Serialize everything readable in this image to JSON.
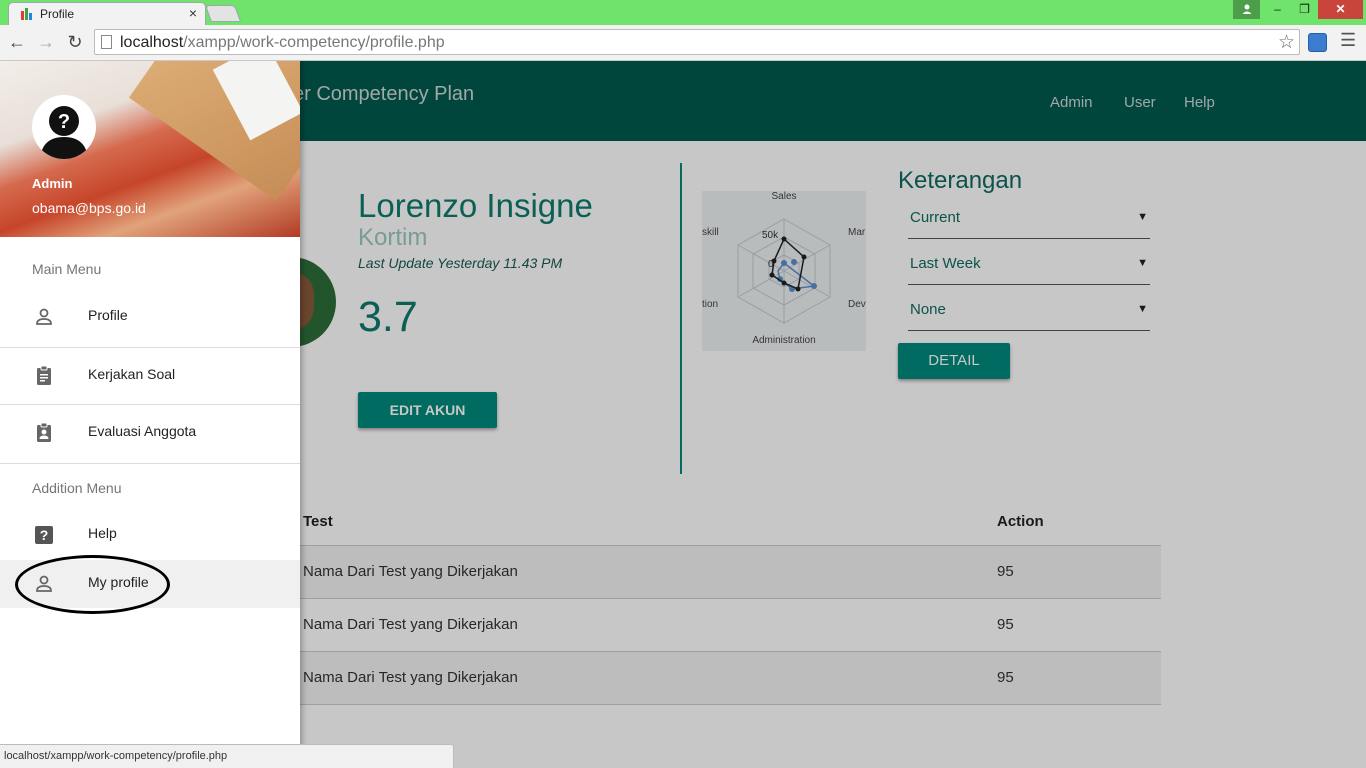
{
  "browser": {
    "tab_title": "Profile",
    "tab_close": "×",
    "url_host": "localhost",
    "url_path": "/xampp/work-competency/profile.php",
    "status_url": "localhost/xampp/work-competency/profile.php",
    "window_buttons": {
      "minimize": "‒",
      "maximize": "❐",
      "close": "✕"
    }
  },
  "header": {
    "title": "e Worker Competency Plan",
    "nav": [
      "Admin",
      "User",
      "Help"
    ]
  },
  "drawer": {
    "user_name": "Admin",
    "user_email": "obama@bps.go.id",
    "main_menu_label": "Main Menu",
    "main_items": [
      {
        "label": "Profile",
        "icon": "person-outline-icon"
      },
      {
        "label": "Kerjakan Soal",
        "icon": "clipboard-icon"
      },
      {
        "label": "Evaluasi Anggota",
        "icon": "assignment-ind-icon"
      }
    ],
    "addition_menu_label": "Addition Menu",
    "addition_items": [
      {
        "label": "Help",
        "icon": "help-icon"
      },
      {
        "label": "My profile",
        "icon": "person-outline-icon",
        "selected": true
      }
    ]
  },
  "profile": {
    "name": "Lorenzo Insigne",
    "role": "Kortim",
    "last_update": "Last Update Yesterday 11.43 PM",
    "score": "3.7",
    "edit_button": "EDIT AKUN"
  },
  "radar": {
    "axis_labels": [
      "Sales",
      "Mar",
      "Dev",
      "Administration",
      "tion",
      "skill"
    ],
    "tick_labels": [
      "50k",
      "0"
    ]
  },
  "keterangan": {
    "title": "Keterangan",
    "selects": [
      "Current",
      "Last Week",
      "None"
    ],
    "detail_button": "DETAIL"
  },
  "table": {
    "headers": [
      "Test",
      "Action"
    ],
    "rows": [
      {
        "test": "Nama Dari Test yang Dikerjakan",
        "action": "95"
      },
      {
        "test": "Nama Dari Test yang Dikerjakan",
        "action": "95"
      },
      {
        "test": "Nama Dari Test yang Dikerjakan",
        "action": "95"
      }
    ]
  },
  "colors": {
    "header_bg": "#005a4f",
    "accent": "#00897b",
    "titlebar": "#6fe36b"
  }
}
